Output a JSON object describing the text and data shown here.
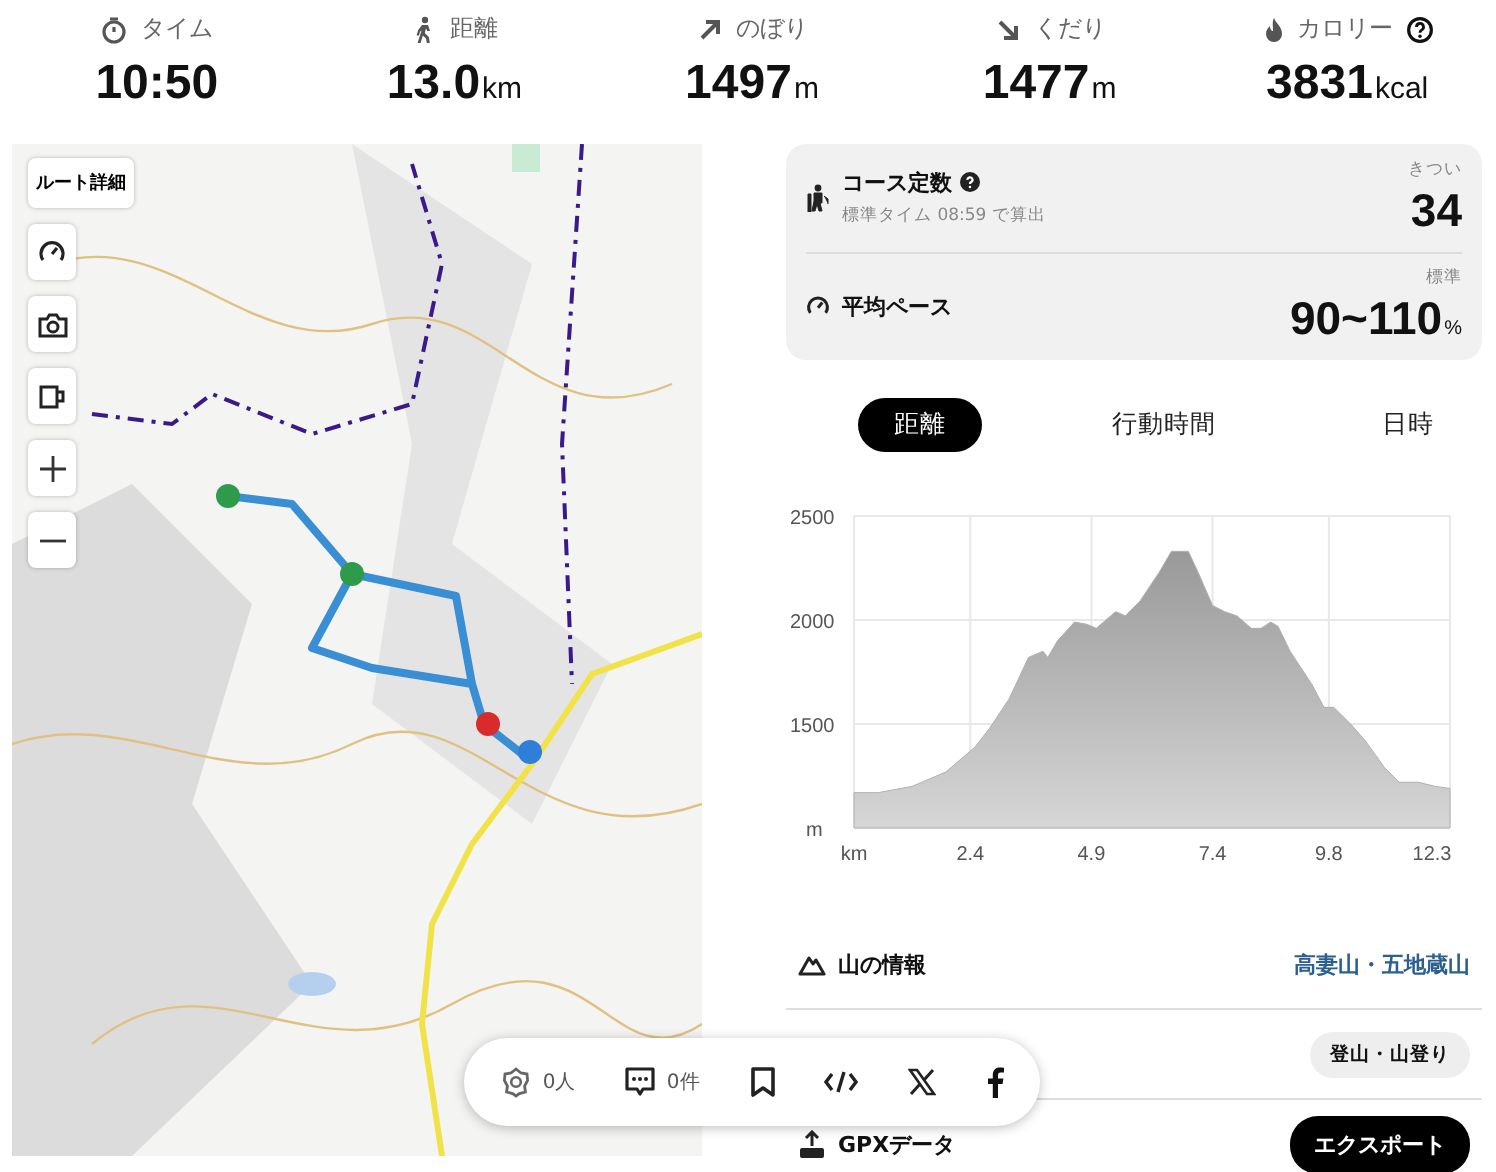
{
  "stats": [
    {
      "kind": "time",
      "label": "タイム",
      "value": "10:50"
    },
    {
      "kind": "distance",
      "label": "距離",
      "value": "13.0",
      "unit": "km"
    },
    {
      "kind": "ascent",
      "label": "のぼり",
      "value": "1497",
      "unit": "m"
    },
    {
      "kind": "descent",
      "label": "くだり",
      "value": "1477",
      "unit": "m"
    },
    {
      "kind": "calorie",
      "label": "カロリー",
      "value": "3831",
      "unit": "kcal",
      "help": true
    }
  ],
  "map": {
    "kind": "picture",
    "route_button": "ルート詳細",
    "controls": [
      {
        "kind": "gauge"
      },
      {
        "kind": "camera"
      },
      {
        "kind": "cup"
      },
      {
        "kind": "zoom-in"
      },
      {
        "kind": "zoom-out"
      }
    ]
  },
  "summary": [
    {
      "kind": "course",
      "title": "コース定数",
      "help": true,
      "note": "標準タイム 08:59 で算出",
      "rating": "きつい",
      "value": "34"
    },
    {
      "kind": "pace",
      "title": "平均ペース",
      "rating": "標準",
      "value": "90~110",
      "unit": "%"
    }
  ],
  "tabs": [
    {
      "label": "距離",
      "selected": true
    },
    {
      "label": "行動時間",
      "selected": false
    },
    {
      "label": "日時",
      "selected": false
    }
  ],
  "chart_data": {
    "type": "area",
    "grid": true,
    "xlim": [
      0,
      12.3
    ],
    "ylim": [
      1000,
      2500
    ],
    "xticks": [
      {
        "value": 0,
        "label": "km"
      },
      2.4,
      4.9,
      7.4,
      9.8,
      12.3
    ],
    "yticks": [
      {
        "value": 1000,
        "label": "m"
      },
      1500,
      2000,
      2500
    ],
    "x": [
      0,
      0.5,
      1.2,
      1.9,
      2.5,
      2.8,
      3.2,
      3.6,
      3.9,
      4.0,
      4.2,
      4.55,
      4.8,
      5.0,
      5.4,
      5.6,
      5.9,
      6.3,
      6.55,
      6.9,
      7.1,
      7.4,
      7.65,
      7.9,
      8.2,
      8.4,
      8.6,
      8.75,
      9.0,
      9.45,
      9.7,
      9.9,
      10.25,
      10.55,
      10.95,
      11.25,
      11.65,
      12.0,
      12.3
    ],
    "series": [
      {
        "color": "#b0b0b0",
        "values": [
          1170,
          1170,
          1200,
          1270,
          1390,
          1480,
          1620,
          1820,
          1850,
          1820,
          1900,
          1990,
          1980,
          1960,
          2040,
          2020,
          2090,
          2230,
          2330,
          2330,
          2230,
          2070,
          2040,
          2020,
          1960,
          1960,
          1990,
          1970,
          1850,
          1690,
          1580,
          1580,
          1500,
          1420,
          1290,
          1220,
          1220,
          1200,
          1190
        ]
      }
    ]
  },
  "info": [
    {
      "kind": "mountain",
      "label": "山の情報",
      "value": "高妻山・五地蔵山"
    },
    {
      "kind": "tag",
      "value": "登山・山登り"
    },
    {
      "kind": "gpx",
      "label": "GPXデータ",
      "value": "エクスポート"
    }
  ],
  "share": [
    {
      "kind": "like",
      "count": "0人"
    },
    {
      "kind": "comment",
      "count": "0件"
    },
    {
      "kind": "bookmark"
    },
    {
      "kind": "embed"
    },
    {
      "kind": "x"
    },
    {
      "kind": "facebook"
    }
  ]
}
